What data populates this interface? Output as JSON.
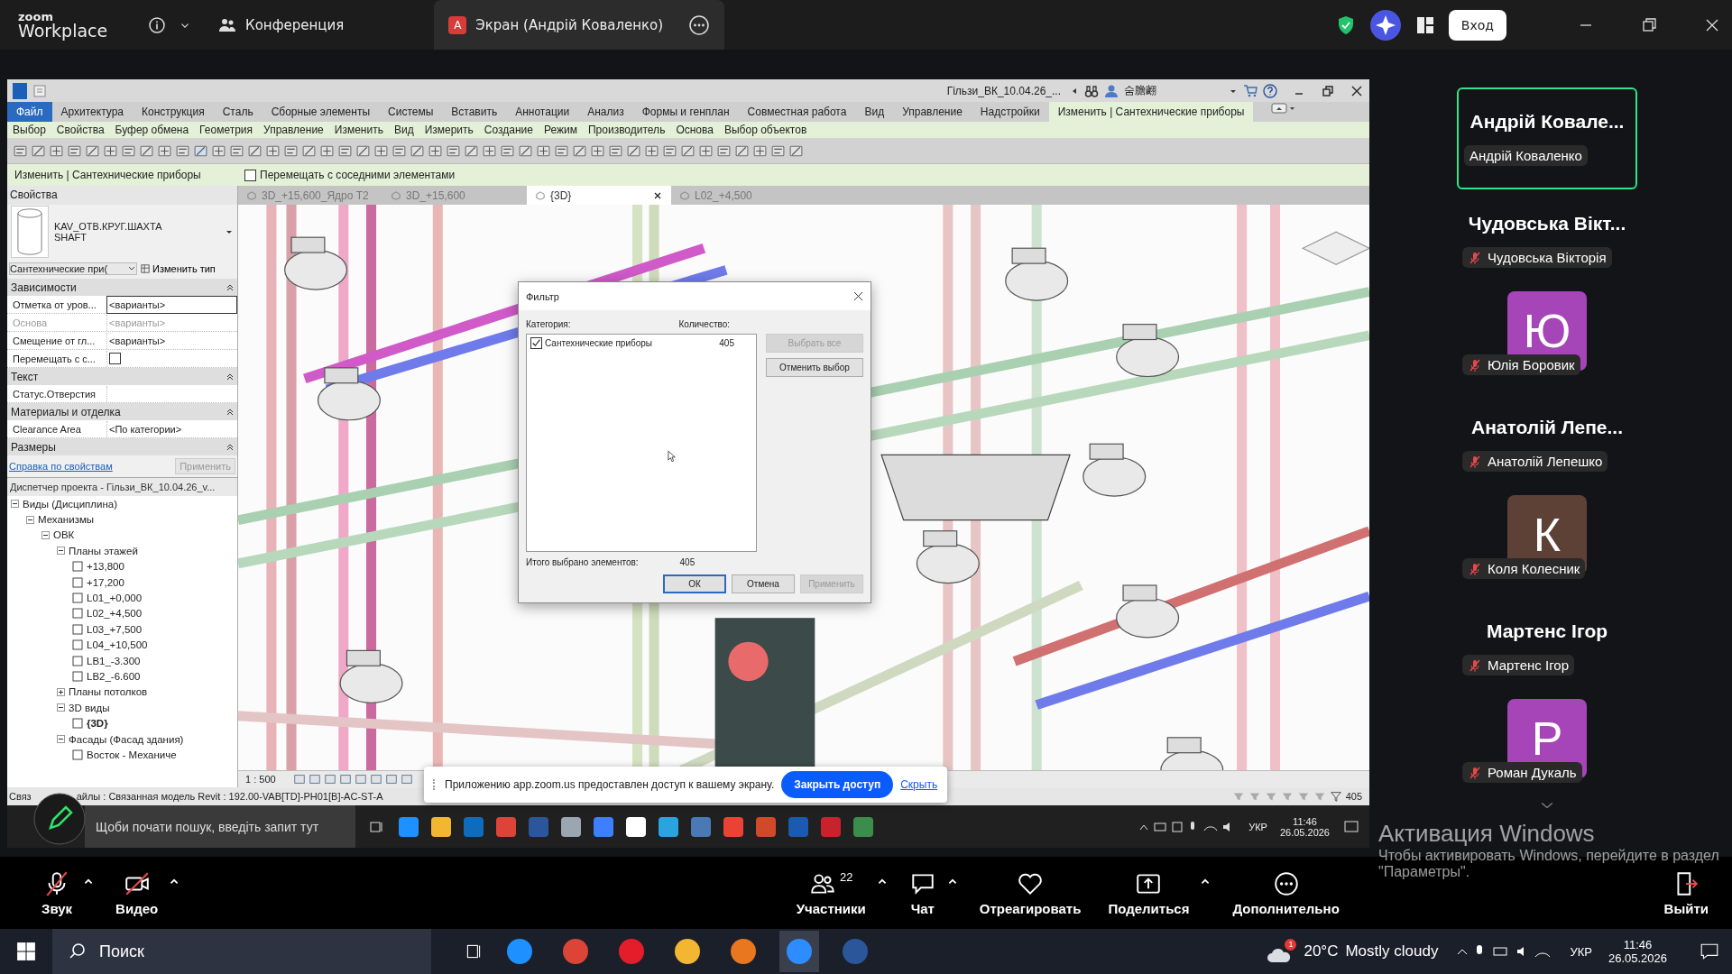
{
  "zoom_header": {
    "brand": "zoom",
    "product": "Workplace",
    "meeting_tab": "Конференция",
    "share_tab": {
      "avatar_letter": "A",
      "label": "Экран (Андрій Коваленко)"
    },
    "sign_in": "Вход"
  },
  "revit": {
    "file_title": "Гільзи_ВК_10.04.26_...",
    "user_name": "숨膽翽",
    "ribbon_tabs": [
      {
        "label": "Файл",
        "kind": "file",
        "selected": false
      },
      {
        "label": "Архитектура",
        "kind": "tab",
        "selected": false
      },
      {
        "label": "Конструкция",
        "kind": "tab",
        "selected": false
      },
      {
        "label": "Сталь",
        "kind": "tab",
        "selected": false
      },
      {
        "label": "Сборные элементы",
        "kind": "tab",
        "selected": false
      },
      {
        "label": "Системы",
        "kind": "tab",
        "selected": false
      },
      {
        "label": "Вставить",
        "kind": "tab",
        "selected": false
      },
      {
        "label": "Аннотации",
        "kind": "tab",
        "selected": false
      },
      {
        "label": "Анализ",
        "kind": "tab",
        "selected": false
      },
      {
        "label": "Формы и генплан",
        "kind": "tab",
        "selected": false
      },
      {
        "label": "Совместная работа",
        "kind": "tab",
        "selected": false
      },
      {
        "label": "Вид",
        "kind": "tab",
        "selected": false
      },
      {
        "label": "Управление",
        "kind": "tab",
        "selected": false
      },
      {
        "label": "Надстройки",
        "kind": "tab",
        "selected": false
      },
      {
        "label": "Изменить | Сантехнические приборы",
        "kind": "tab",
        "selected": true
      }
    ],
    "panel_labels": [
      "Выбор",
      "Свойства",
      "Буфер обмена",
      "Геометрия",
      "Управление",
      "Изменить",
      "Вид",
      "Измерить",
      "Создание",
      "Режим",
      "Производитель",
      "Основа",
      "Выбор объектов"
    ],
    "options_bar": {
      "context": "Изменить | Сантехнические приборы",
      "move_with_nearby": {
        "label": "Перемещать с соседними элементами",
        "checked": false
      }
    },
    "view_tabs": [
      {
        "label": "3D_+15,600_Ядро Т2",
        "selected": false
      },
      {
        "label": "3D_+15,600",
        "selected": false
      },
      {
        "label": "{3D}",
        "selected": true
      },
      {
        "label": "L02_+4,500",
        "selected": false
      }
    ],
    "properties": {
      "title": "Свойства",
      "type_name": "KAV_ОТВ.КРУГ.ШАХТА\nSHAFT",
      "filter": "Сантехнические при(",
      "edit_type": "Изменить тип",
      "groups": [
        {
          "name": "Зависимости",
          "rows": [
            {
              "label": "Отметка от уров...",
              "value": "<варианты>",
              "kind": "text",
              "disabled": false
            },
            {
              "label": "Основа",
              "value": "<варианты>",
              "kind": "text",
              "disabled": true
            },
            {
              "label": "Смещение от гл...",
              "value": "<варианты>",
              "kind": "text",
              "disabled": false
            },
            {
              "label": "Перемещать с с...",
              "kind": "check",
              "checked": false,
              "disabled": false
            }
          ]
        },
        {
          "name": "Текст",
          "rows": [
            {
              "label": "Статус.Отверстия",
              "kind": "text",
              "disabled": false
            }
          ]
        },
        {
          "name": "Материалы и отделка",
          "rows": [
            {
              "label": "Clearance Area",
              "value": "<По категории>",
              "kind": "text",
              "disabled": false
            }
          ]
        },
        {
          "name": "Размеры"
        }
      ],
      "help_link": "Справка по свойствам",
      "apply": "Применить"
    },
    "project_browser": {
      "title": "Диспетчер проекта - Гільзи_ВК_10.04.26_v...",
      "tree": [
        {
          "label": "Виды (Дисциплина)",
          "expanded": true,
          "children": [
            {
              "label": "Механизмы",
              "expanded": true,
              "children": [
                {
                  "label": "ОВК",
                  "expanded": true,
                  "children": [
                    {
                      "label": "Планы этажей",
                      "expanded": true,
                      "children": [
                        {
                          "label": "+13,800",
                          "current": false
                        },
                        {
                          "label": "+17,200",
                          "current": false
                        },
                        {
                          "label": "L01_+0,000",
                          "current": false
                        },
                        {
                          "label": "L02_+4,500",
                          "current": false
                        },
                        {
                          "label": "L03_+7,500",
                          "current": false
                        },
                        {
                          "label": "L04_+10,500",
                          "current": false
                        },
                        {
                          "label": "LB1_-3.300",
                          "current": false
                        },
                        {
                          "label": "LB2_-6.600",
                          "current": false
                        }
                      ]
                    },
                    {
                      "label": "Планы потолков",
                      "expanded": false
                    },
                    {
                      "label": "3D виды",
                      "expanded": true,
                      "children": [
                        {
                          "label": "{3D}",
                          "current": true
                        }
                      ]
                    },
                    {
                      "label": "Фасады (Фасад здания)",
                      "expanded": true,
                      "children": [
                        {
                          "label": "Восток - Механиче",
                          "current": false
                        }
                      ]
                    }
                  ]
                }
              ]
            }
          ]
        }
      ]
    },
    "scale": "1 : 500",
    "status_text": "Связ",
    "status_text_2": "айлы : Связанная модель Revit : 192.00-VAB[TD]-PH01[B]-AC-ST-A",
    "selection_count": "405",
    "filter_dialog": {
      "title": "Фильтр",
      "category_header": "Категория:",
      "count_header": "Количество:",
      "items": [
        {
          "label": "Сантехнические приборы",
          "count": "405",
          "checked": true
        }
      ],
      "select_all": "Выбрать все",
      "deselect": "Отменить выбор",
      "total_label": "Итого выбрано элементов:",
      "total": "405",
      "ok": "ОК",
      "cancel": "Отмена",
      "apply": "Применить"
    }
  },
  "share_notice": {
    "text": "Приложению app.zoom.us предоставлен доступ к вашему экрану.",
    "stop": "Закрыть доступ",
    "hide": "Скрыть"
  },
  "remote_taskbar": {
    "search": "Щоби почати пошук, введіть запит тут",
    "language": "УКР",
    "time": "11:46",
    "date": "26.05.2026"
  },
  "participants": [
    {
      "kind": "name",
      "title": "Андрій Ковале...",
      "label": "Андрій Коваленко",
      "muted": false,
      "speaking": true
    },
    {
      "kind": "name",
      "title": "Чудовська Вікт...",
      "label": "Чудовська Вікторія",
      "muted": true,
      "speaking": false
    },
    {
      "kind": "avatar",
      "letter": "Ю",
      "color": "#a645b8",
      "label": "Юлія Боровик",
      "muted": true,
      "speaking": false
    },
    {
      "kind": "name",
      "title": "Анатолій Лепе...",
      "label": "Анатолій Лепешко",
      "muted": true,
      "speaking": false
    },
    {
      "kind": "avatar",
      "letter": "К",
      "color": "#5e4136",
      "label": "Коля Колесник",
      "muted": true,
      "speaking": false
    },
    {
      "kind": "name",
      "title": "Мартенс Ігор",
      "label": "Мартенс Ігор",
      "muted": true,
      "speaking": false
    },
    {
      "kind": "avatar",
      "letter": "Р",
      "color": "#a645b8",
      "label": "Роман Дукаль",
      "muted": true,
      "speaking": false
    }
  ],
  "activation": {
    "title": "Активация Windows",
    "text": "Чтобы активировать Windows, перейдите в раздел\n\"Параметры\"."
  },
  "controls": [
    {
      "label": "Звук",
      "kind": "mic",
      "off": true,
      "caret": true
    },
    {
      "label": "Видео",
      "kind": "video",
      "off": true,
      "caret": true
    },
    {
      "label": "Участники",
      "kind": "people",
      "count": "22",
      "caret": true
    },
    {
      "label": "Чат",
      "kind": "chat",
      "caret": true
    },
    {
      "label": "Отреагировать",
      "kind": "heart",
      "caret": false
    },
    {
      "label": "Поделиться",
      "kind": "share",
      "caret": true
    },
    {
      "label": "Дополнительно",
      "kind": "more",
      "caret": false
    }
  ],
  "leave": "Выйти",
  "taskbar": {
    "search": "Поиск",
    "weather_badge": "1",
    "temperature": "20°C",
    "weather": "Mostly cloudy",
    "language": "УКР",
    "time": "11:46",
    "date": "26.05.2026"
  }
}
